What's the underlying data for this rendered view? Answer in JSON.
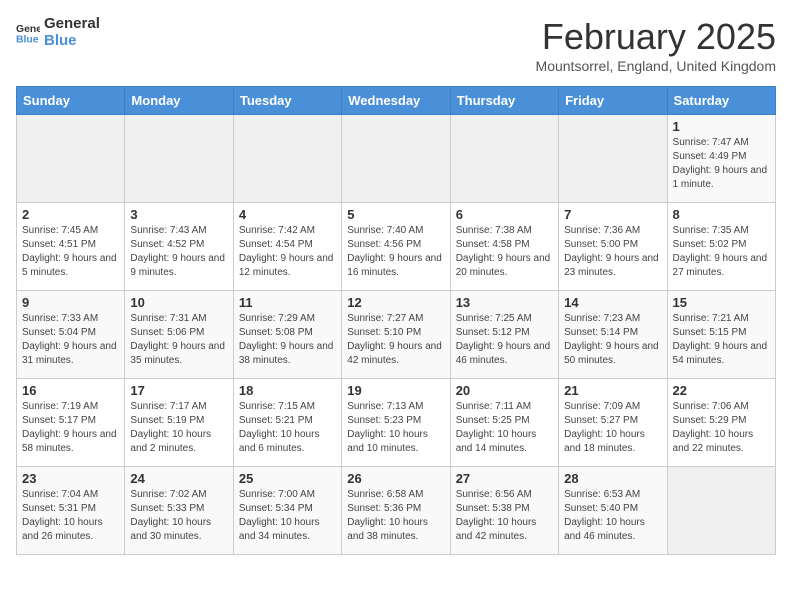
{
  "logo": {
    "general": "General",
    "blue": "Blue"
  },
  "title": "February 2025",
  "subtitle": "Mountsorrel, England, United Kingdom",
  "days_of_week": [
    "Sunday",
    "Monday",
    "Tuesday",
    "Wednesday",
    "Thursday",
    "Friday",
    "Saturday"
  ],
  "weeks": [
    [
      {
        "day": "",
        "info": ""
      },
      {
        "day": "",
        "info": ""
      },
      {
        "day": "",
        "info": ""
      },
      {
        "day": "",
        "info": ""
      },
      {
        "day": "",
        "info": ""
      },
      {
        "day": "",
        "info": ""
      },
      {
        "day": "1",
        "info": "Sunrise: 7:47 AM\nSunset: 4:49 PM\nDaylight: 9 hours and 1 minute."
      }
    ],
    [
      {
        "day": "2",
        "info": "Sunrise: 7:45 AM\nSunset: 4:51 PM\nDaylight: 9 hours and 5 minutes."
      },
      {
        "day": "3",
        "info": "Sunrise: 7:43 AM\nSunset: 4:52 PM\nDaylight: 9 hours and 9 minutes."
      },
      {
        "day": "4",
        "info": "Sunrise: 7:42 AM\nSunset: 4:54 PM\nDaylight: 9 hours and 12 minutes."
      },
      {
        "day": "5",
        "info": "Sunrise: 7:40 AM\nSunset: 4:56 PM\nDaylight: 9 hours and 16 minutes."
      },
      {
        "day": "6",
        "info": "Sunrise: 7:38 AM\nSunset: 4:58 PM\nDaylight: 9 hours and 20 minutes."
      },
      {
        "day": "7",
        "info": "Sunrise: 7:36 AM\nSunset: 5:00 PM\nDaylight: 9 hours and 23 minutes."
      },
      {
        "day": "8",
        "info": "Sunrise: 7:35 AM\nSunset: 5:02 PM\nDaylight: 9 hours and 27 minutes."
      }
    ],
    [
      {
        "day": "9",
        "info": "Sunrise: 7:33 AM\nSunset: 5:04 PM\nDaylight: 9 hours and 31 minutes."
      },
      {
        "day": "10",
        "info": "Sunrise: 7:31 AM\nSunset: 5:06 PM\nDaylight: 9 hours and 35 minutes."
      },
      {
        "day": "11",
        "info": "Sunrise: 7:29 AM\nSunset: 5:08 PM\nDaylight: 9 hours and 38 minutes."
      },
      {
        "day": "12",
        "info": "Sunrise: 7:27 AM\nSunset: 5:10 PM\nDaylight: 9 hours and 42 minutes."
      },
      {
        "day": "13",
        "info": "Sunrise: 7:25 AM\nSunset: 5:12 PM\nDaylight: 9 hours and 46 minutes."
      },
      {
        "day": "14",
        "info": "Sunrise: 7:23 AM\nSunset: 5:14 PM\nDaylight: 9 hours and 50 minutes."
      },
      {
        "day": "15",
        "info": "Sunrise: 7:21 AM\nSunset: 5:15 PM\nDaylight: 9 hours and 54 minutes."
      }
    ],
    [
      {
        "day": "16",
        "info": "Sunrise: 7:19 AM\nSunset: 5:17 PM\nDaylight: 9 hours and 58 minutes."
      },
      {
        "day": "17",
        "info": "Sunrise: 7:17 AM\nSunset: 5:19 PM\nDaylight: 10 hours and 2 minutes."
      },
      {
        "day": "18",
        "info": "Sunrise: 7:15 AM\nSunset: 5:21 PM\nDaylight: 10 hours and 6 minutes."
      },
      {
        "day": "19",
        "info": "Sunrise: 7:13 AM\nSunset: 5:23 PM\nDaylight: 10 hours and 10 minutes."
      },
      {
        "day": "20",
        "info": "Sunrise: 7:11 AM\nSunset: 5:25 PM\nDaylight: 10 hours and 14 minutes."
      },
      {
        "day": "21",
        "info": "Sunrise: 7:09 AM\nSunset: 5:27 PM\nDaylight: 10 hours and 18 minutes."
      },
      {
        "day": "22",
        "info": "Sunrise: 7:06 AM\nSunset: 5:29 PM\nDaylight: 10 hours and 22 minutes."
      }
    ],
    [
      {
        "day": "23",
        "info": "Sunrise: 7:04 AM\nSunset: 5:31 PM\nDaylight: 10 hours and 26 minutes."
      },
      {
        "day": "24",
        "info": "Sunrise: 7:02 AM\nSunset: 5:33 PM\nDaylight: 10 hours and 30 minutes."
      },
      {
        "day": "25",
        "info": "Sunrise: 7:00 AM\nSunset: 5:34 PM\nDaylight: 10 hours and 34 minutes."
      },
      {
        "day": "26",
        "info": "Sunrise: 6:58 AM\nSunset: 5:36 PM\nDaylight: 10 hours and 38 minutes."
      },
      {
        "day": "27",
        "info": "Sunrise: 6:56 AM\nSunset: 5:38 PM\nDaylight: 10 hours and 42 minutes."
      },
      {
        "day": "28",
        "info": "Sunrise: 6:53 AM\nSunset: 5:40 PM\nDaylight: 10 hours and 46 minutes."
      },
      {
        "day": "",
        "info": ""
      }
    ]
  ]
}
